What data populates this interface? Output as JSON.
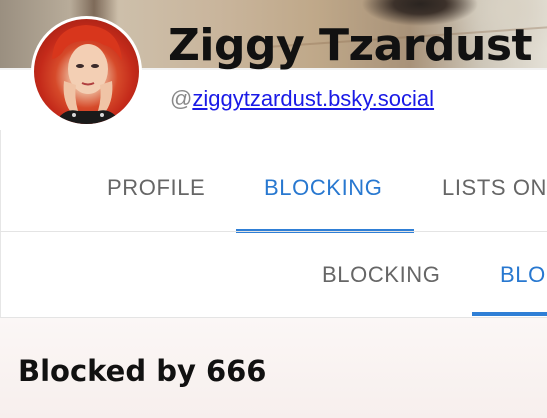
{
  "profile": {
    "display_name": "Ziggy Tzardust",
    "handle_prefix": "@",
    "handle": "ziggytzardust.bsky.social"
  },
  "tabs": [
    {
      "label": "PROFILE",
      "active": false
    },
    {
      "label": "BLOCKING",
      "active": true
    },
    {
      "label": "LISTS ON",
      "active": false
    }
  ],
  "subtabs": [
    {
      "label": "BLOCKING",
      "active": false
    },
    {
      "label": "BLO",
      "active": true
    }
  ],
  "content": {
    "title": "Blocked by 666"
  },
  "colors": {
    "accent": "#2878d0",
    "link": "#1a1ae6",
    "tab_inactive": "#666666",
    "avatar_background": "#c42a1a"
  }
}
